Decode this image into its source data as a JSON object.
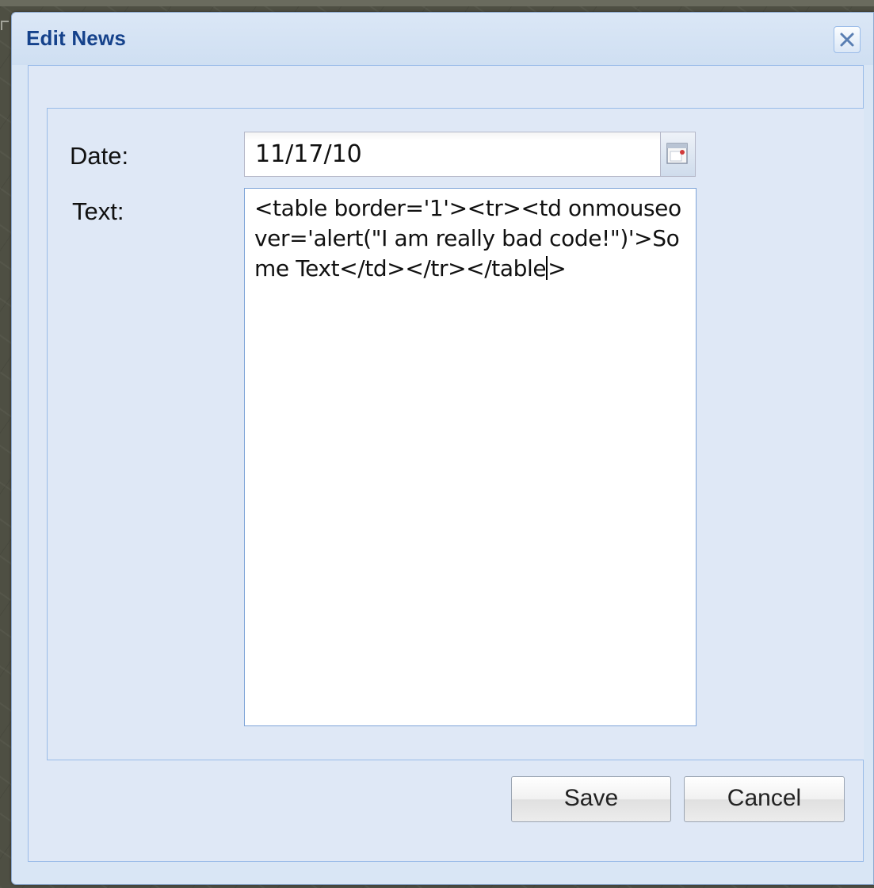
{
  "dialog": {
    "title": "Edit News"
  },
  "form": {
    "date_label": "Date:",
    "date_value": "11/17/10",
    "text_label": "Text:",
    "text_value": "<table border='1'><tr><td onmouseover='alert(\"I am really bad code!\")'>Some Text</td></tr></table",
    "text_value_after_caret": ">"
  },
  "buttons": {
    "save_label": "Save",
    "cancel_label": "Cancel"
  },
  "icons": {
    "close": "close-icon",
    "date_picker": "calendar-icon"
  },
  "colors": {
    "title": "#15428b",
    "window_background": "#d9e6f5",
    "border": "#99bbe8"
  }
}
